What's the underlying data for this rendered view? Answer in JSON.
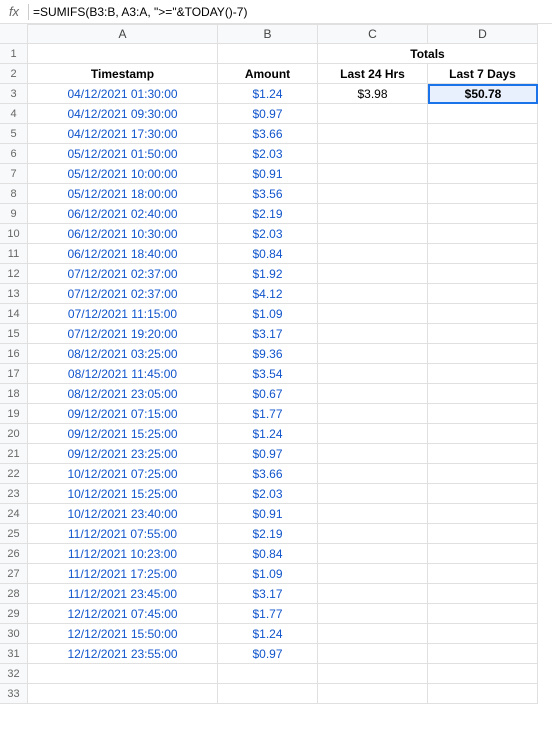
{
  "formulaBar": {
    "fx": "fx",
    "cellRef": "D3",
    "formula": "=SUMIFS(B3:B, A3:A, \">=\"&TODAY()-7)"
  },
  "columns": {
    "rowNum": "",
    "A": "A",
    "B": "B",
    "C": "C",
    "D": "D"
  },
  "rows": [
    {
      "num": "1",
      "A": "",
      "B": "",
      "C": "",
      "D": "Totals",
      "totalsSpan": true
    },
    {
      "num": "2",
      "A": "Timestamp",
      "B": "Amount",
      "C": "Last 24 Hrs",
      "D": "Last 7 Days"
    },
    {
      "num": "3",
      "A": "04/12/2021 01:30:00",
      "B": "$1.24",
      "C": "$3.98",
      "D": "$50.78",
      "selectedD": true
    },
    {
      "num": "4",
      "A": "04/12/2021 09:30:00",
      "B": "$0.97",
      "C": "",
      "D": ""
    },
    {
      "num": "5",
      "A": "04/12/2021 17:30:00",
      "B": "$3.66",
      "C": "",
      "D": ""
    },
    {
      "num": "6",
      "A": "05/12/2021 01:50:00",
      "B": "$2.03",
      "C": "",
      "D": ""
    },
    {
      "num": "7",
      "A": "05/12/2021 10:00:00",
      "B": "$0.91",
      "C": "",
      "D": ""
    },
    {
      "num": "8",
      "A": "05/12/2021 18:00:00",
      "B": "$3.56",
      "C": "",
      "D": ""
    },
    {
      "num": "9",
      "A": "06/12/2021 02:40:00",
      "B": "$2.19",
      "C": "",
      "D": ""
    },
    {
      "num": "10",
      "A": "06/12/2021 10:30:00",
      "B": "$2.03",
      "C": "",
      "D": ""
    },
    {
      "num": "11",
      "A": "06/12/2021 18:40:00",
      "B": "$0.84",
      "C": "",
      "D": ""
    },
    {
      "num": "12",
      "A": "07/12/2021 02:37:00",
      "B": "$1.92",
      "C": "",
      "D": ""
    },
    {
      "num": "13",
      "A": "07/12/2021 02:37:00",
      "B": "$4.12",
      "C": "",
      "D": ""
    },
    {
      "num": "14",
      "A": "07/12/2021 11:15:00",
      "B": "$1.09",
      "C": "",
      "D": ""
    },
    {
      "num": "15",
      "A": "07/12/2021 19:20:00",
      "B": "$3.17",
      "C": "",
      "D": ""
    },
    {
      "num": "16",
      "A": "08/12/2021 03:25:00",
      "B": "$9.36",
      "C": "",
      "D": ""
    },
    {
      "num": "17",
      "A": "08/12/2021 11:45:00",
      "B": "$3.54",
      "C": "",
      "D": ""
    },
    {
      "num": "18",
      "A": "08/12/2021 23:05:00",
      "B": "$0.67",
      "C": "",
      "D": ""
    },
    {
      "num": "19",
      "A": "09/12/2021 07:15:00",
      "B": "$1.77",
      "C": "",
      "D": ""
    },
    {
      "num": "20",
      "A": "09/12/2021 15:25:00",
      "B": "$1.24",
      "C": "",
      "D": ""
    },
    {
      "num": "21",
      "A": "09/12/2021 23:25:00",
      "B": "$0.97",
      "C": "",
      "D": ""
    },
    {
      "num": "22",
      "A": "10/12/2021 07:25:00",
      "B": "$3.66",
      "C": "",
      "D": ""
    },
    {
      "num": "23",
      "A": "10/12/2021 15:25:00",
      "B": "$2.03",
      "C": "",
      "D": ""
    },
    {
      "num": "24",
      "A": "10/12/2021 23:40:00",
      "B": "$0.91",
      "C": "",
      "D": ""
    },
    {
      "num": "25",
      "A": "11/12/2021 07:55:00",
      "B": "$2.19",
      "C": "",
      "D": ""
    },
    {
      "num": "26",
      "A": "11/12/2021 10:23:00",
      "B": "$0.84",
      "C": "",
      "D": ""
    },
    {
      "num": "27",
      "A": "11/12/2021 17:25:00",
      "B": "$1.09",
      "C": "",
      "D": ""
    },
    {
      "num": "28",
      "A": "11/12/2021 23:45:00",
      "B": "$3.17",
      "C": "",
      "D": ""
    },
    {
      "num": "29",
      "A": "12/12/2021 07:45:00",
      "B": "$1.77",
      "C": "",
      "D": ""
    },
    {
      "num": "30",
      "A": "12/12/2021 15:50:00",
      "B": "$1.24",
      "C": "",
      "D": ""
    },
    {
      "num": "31",
      "A": "12/12/2021 23:55:00",
      "B": "$0.97",
      "C": "",
      "D": ""
    },
    {
      "num": "32",
      "A": "",
      "B": "",
      "C": "",
      "D": ""
    },
    {
      "num": "33",
      "A": "",
      "B": "",
      "C": "",
      "D": ""
    }
  ]
}
